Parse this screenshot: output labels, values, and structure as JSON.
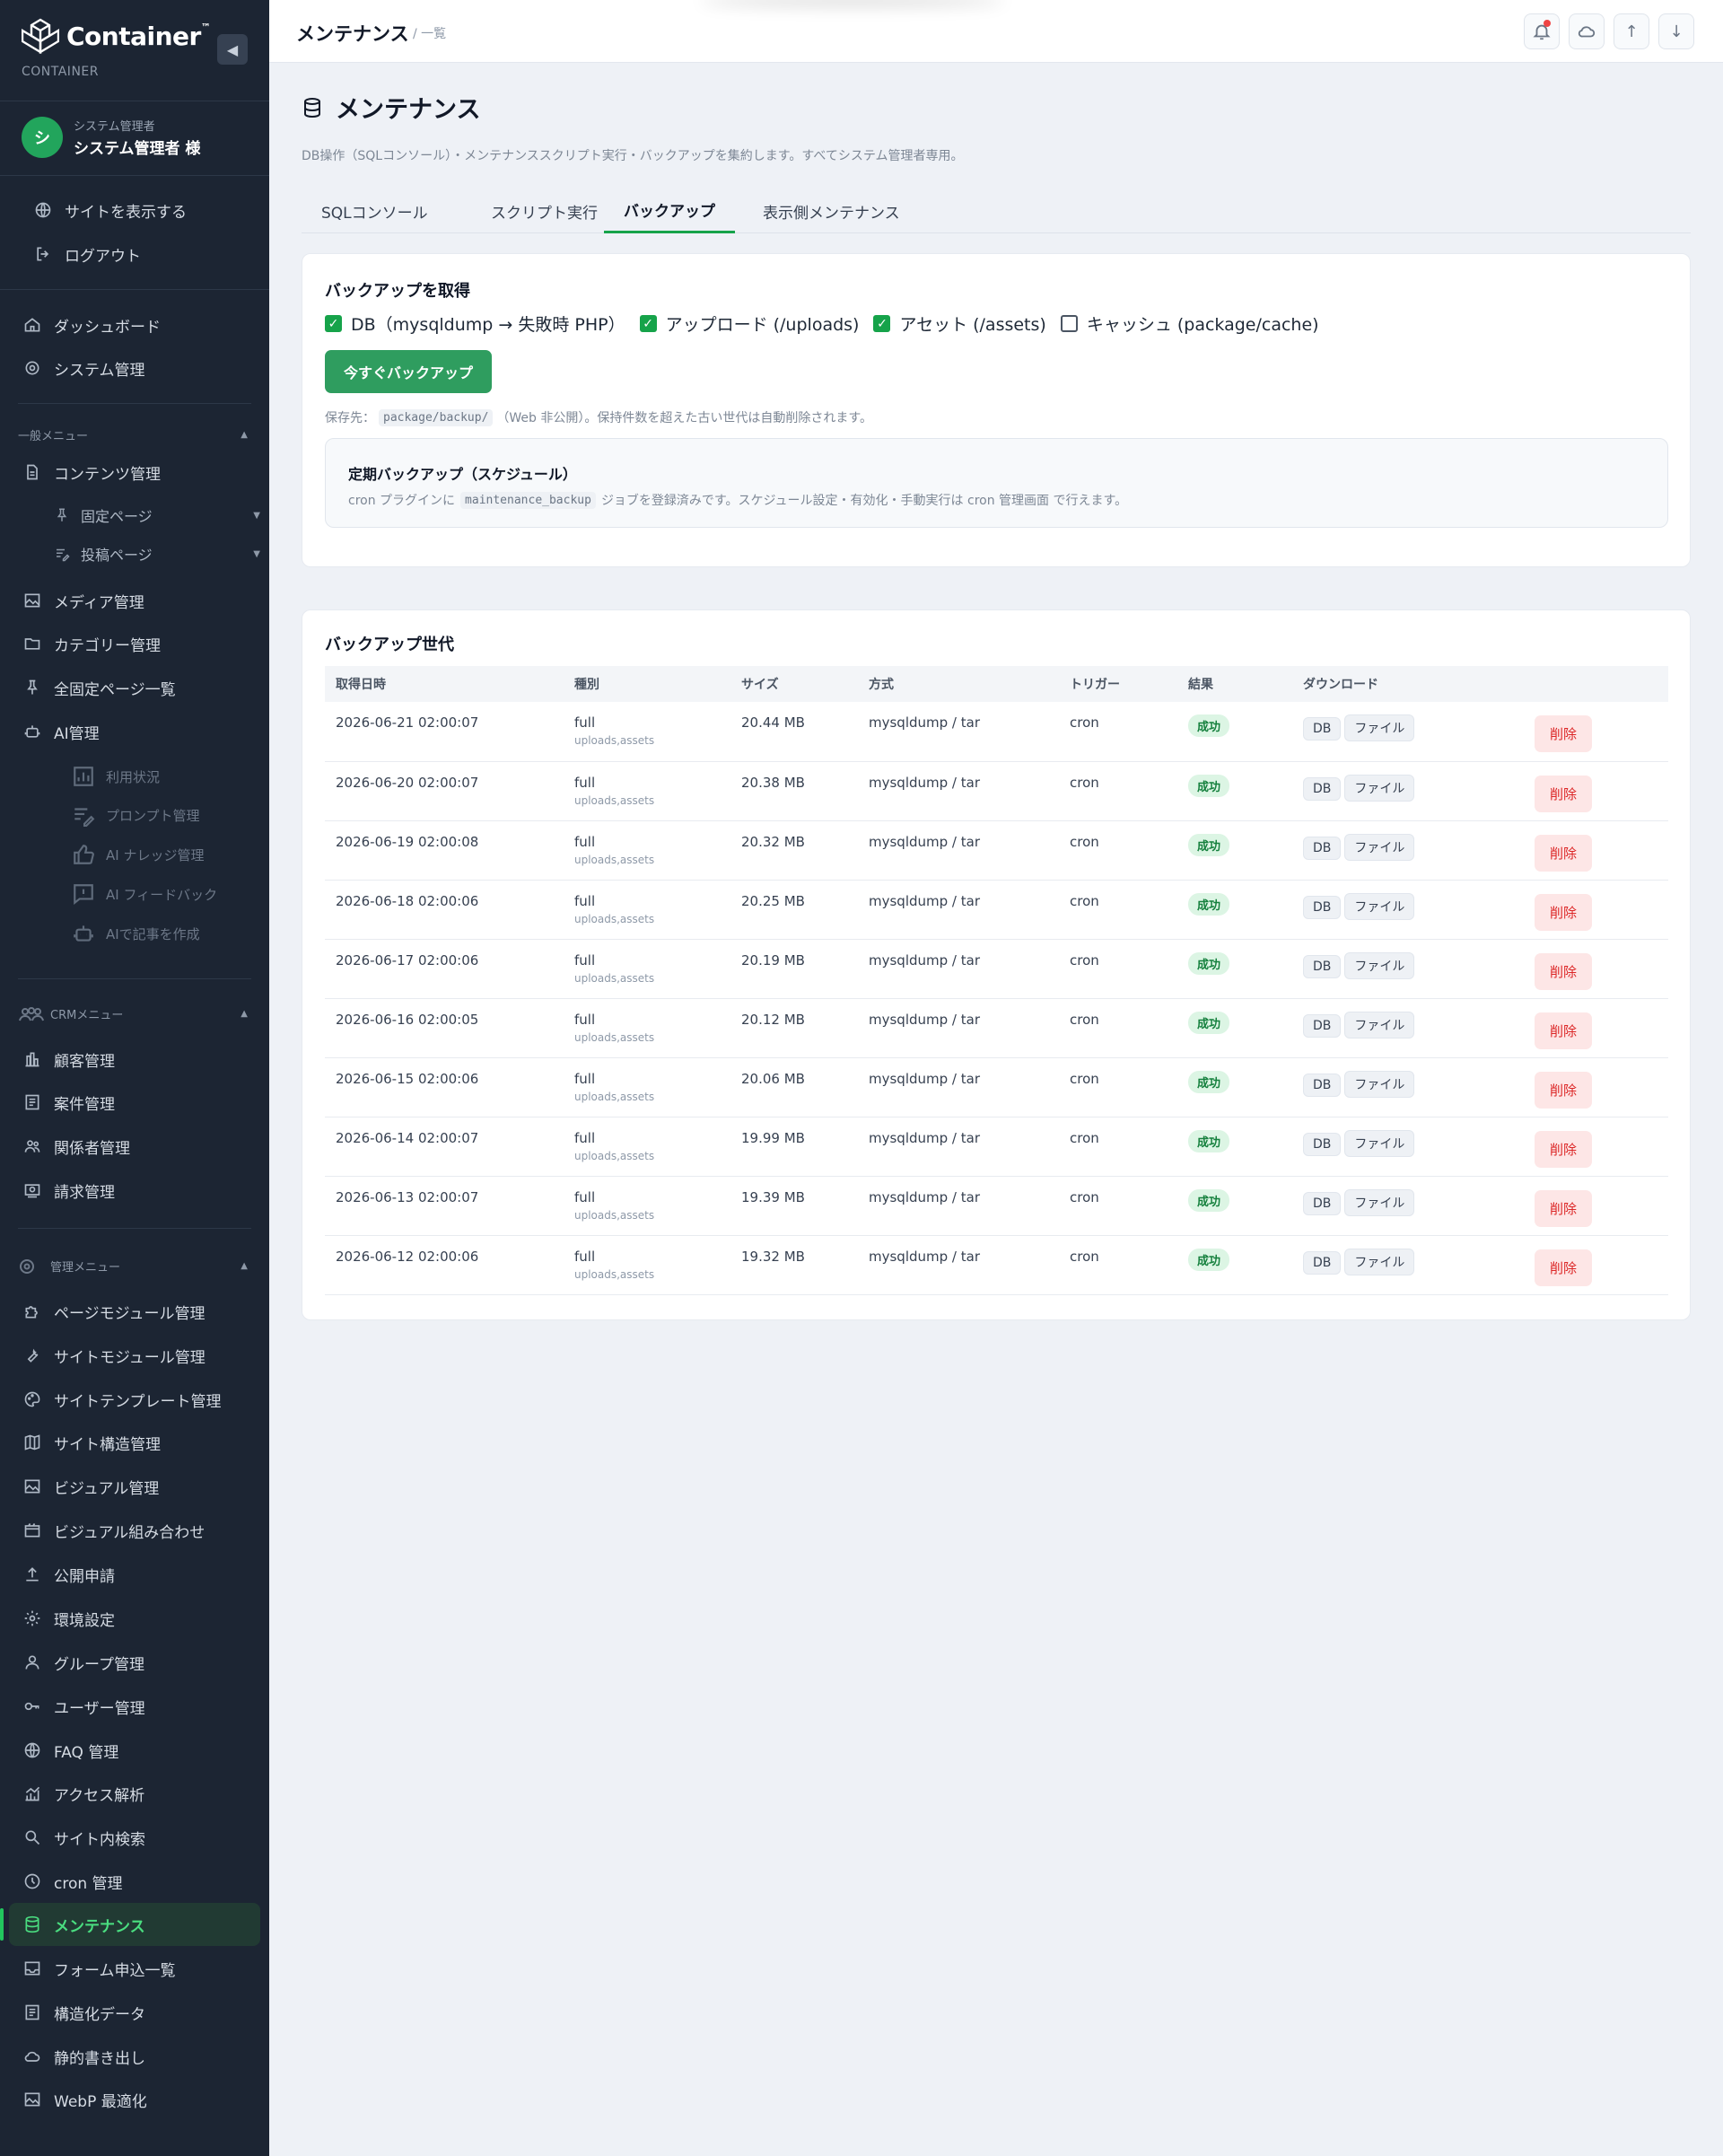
{
  "sidebar": {
    "brand": "Container",
    "brand_tm": "™",
    "brand_sub": "CONTAINER",
    "user_initial": "シ",
    "user_role": "システム管理者",
    "user_name": "システム管理者 様",
    "links": [
      {
        "label": "サイトを表示する",
        "icon": "globe-icon"
      },
      {
        "label": "ログアウト",
        "icon": "logout-icon"
      }
    ],
    "top_items": [
      {
        "label": "ダッシュボード",
        "icon": "home-icon"
      },
      {
        "label": "システム管理",
        "icon": "settings-icon"
      }
    ],
    "general_label": "一般メニュー",
    "general_items": [
      {
        "label": "コンテンツ管理",
        "icon": "document-icon"
      },
      {
        "label": "固定ページ",
        "icon": "pin-icon"
      },
      {
        "label": "投稿ページ",
        "icon": "post-icon"
      },
      {
        "label": "メディア管理",
        "icon": "image-icon"
      },
      {
        "label": "カテゴリー管理",
        "icon": "folder-icon"
      },
      {
        "label": "全固定ページ一覧",
        "icon": "pin-icon"
      },
      {
        "label": "AI管理",
        "icon": "robot-icon"
      }
    ],
    "ai_items": [
      {
        "label": "利用状況",
        "icon": "chart-icon"
      },
      {
        "label": "プロンプト管理",
        "icon": "edit-icon"
      },
      {
        "label": "AI ナレッジ管理",
        "icon": "thumbs-up-icon"
      },
      {
        "label": "AI フィードバック",
        "icon": "feedback-icon"
      },
      {
        "label": "AIで記事を作成",
        "icon": "robot-icon"
      }
    ],
    "crm_label": "CRMメニュー",
    "crm_items": [
      {
        "label": "顧客管理",
        "icon": "building-icon"
      },
      {
        "label": "案件管理",
        "icon": "list-icon"
      },
      {
        "label": "関係者管理",
        "icon": "people-icon"
      },
      {
        "label": "請求管理",
        "icon": "invoice-icon"
      }
    ],
    "admin_label": "管理メニュー",
    "admin_items": [
      {
        "label": "ページモジュール管理",
        "icon": "puzzle-icon"
      },
      {
        "label": "サイトモジュール管理",
        "icon": "wrench-icon"
      },
      {
        "label": "サイトテンプレート管理",
        "icon": "palette-icon"
      },
      {
        "label": "サイト構造管理",
        "icon": "map-icon"
      },
      {
        "label": "ビジュアル管理",
        "icon": "image-icon"
      },
      {
        "label": "ビジュアル組み合わせ",
        "icon": "film-icon"
      },
      {
        "label": "公開申請",
        "icon": "upload-icon"
      },
      {
        "label": "環境設定",
        "icon": "gear-icon"
      },
      {
        "label": "グループ管理",
        "icon": "user-icon"
      },
      {
        "label": "ユーザー管理",
        "icon": "key-icon"
      },
      {
        "label": "FAQ 管理",
        "icon": "globe-icon"
      },
      {
        "label": "アクセス解析",
        "icon": "analytics-icon"
      },
      {
        "label": "サイト内検索",
        "icon": "search-icon"
      },
      {
        "label": "cron 管理",
        "icon": "clock-icon"
      },
      {
        "label": "メンテナンス",
        "icon": "database-icon"
      },
      {
        "label": "フォーム申込一覧",
        "icon": "inbox-icon"
      },
      {
        "label": "構造化データ",
        "icon": "list-icon"
      },
      {
        "label": "静的書き出し",
        "icon": "cloud-icon"
      },
      {
        "label": "WebP 最適化",
        "icon": "image-icon"
      }
    ]
  },
  "header": {
    "title": "メンテナンス",
    "crumb": "/ 一覧",
    "buttons": [
      {
        "icon": "bell-icon"
      },
      {
        "icon": "cloud-icon"
      },
      {
        "icon": "arrow-up-icon",
        "glyph": "↑"
      },
      {
        "icon": "arrow-down-icon",
        "glyph": "↓"
      }
    ]
  },
  "page": {
    "title": "メンテナンス",
    "description": "DB操作（SQLコンソール）・メンテナンススクリプト実行・バックアップを集約します。すべてシステム管理者専用。",
    "tabs": [
      {
        "label": "SQLコンソール",
        "active": false
      },
      {
        "label": "スクリプト実行",
        "active": false
      },
      {
        "label": "バックアップ",
        "active": true
      },
      {
        "label": "表示側メンテナンス",
        "active": false
      }
    ]
  },
  "backup": {
    "title": "バックアップを取得",
    "options": [
      {
        "label": "DB（mysqldump → 失敗時 PHP）",
        "checked": true
      },
      {
        "label": "アップロード (/uploads)",
        "checked": true
      },
      {
        "label": "アセット (/assets)",
        "checked": true
      },
      {
        "label": "キャッシュ (package/cache)",
        "checked": false
      }
    ],
    "button_label": "今すぐバックアップ",
    "save_prefix": "保存先：",
    "save_path": "package/backup/",
    "save_suffix": "（Web 非公開）。保持件数を超えた古い世代は自動削除されます。",
    "schedule_title": "定期バックアップ（スケジュール）",
    "schedule_prefix": "cron プラグインに",
    "schedule_job": "maintenance_backup",
    "schedule_suffix": "ジョブを登録済みです。スケジュール設定・有効化・手動実行は cron 管理画面 で行えます。"
  },
  "generations": {
    "title": "バックアップ世代",
    "columns": [
      "取得日時",
      "種別",
      "サイズ",
      "方式",
      "トリガー",
      "結果",
      "ダウンロード",
      ""
    ],
    "download_db_label": "DB",
    "download_file_label": "ファイル",
    "delete_label": "削除",
    "rows": [
      {
        "datetime": "2026-06-21 02:00:07",
        "type": "full",
        "targets": "uploads,assets",
        "size": "20.44 MB",
        "method": "mysqldump / tar",
        "trigger": "cron",
        "result": "成功"
      },
      {
        "datetime": "2026-06-20 02:00:07",
        "type": "full",
        "targets": "uploads,assets",
        "size": "20.38 MB",
        "method": "mysqldump / tar",
        "trigger": "cron",
        "result": "成功"
      },
      {
        "datetime": "2026-06-19 02:00:08",
        "type": "full",
        "targets": "uploads,assets",
        "size": "20.32 MB",
        "method": "mysqldump / tar",
        "trigger": "cron",
        "result": "成功"
      },
      {
        "datetime": "2026-06-18 02:00:06",
        "type": "full",
        "targets": "uploads,assets",
        "size": "20.25 MB",
        "method": "mysqldump / tar",
        "trigger": "cron",
        "result": "成功"
      },
      {
        "datetime": "2026-06-17 02:00:06",
        "type": "full",
        "targets": "uploads,assets",
        "size": "20.19 MB",
        "method": "mysqldump / tar",
        "trigger": "cron",
        "result": "成功"
      },
      {
        "datetime": "2026-06-16 02:00:05",
        "type": "full",
        "targets": "uploads,assets",
        "size": "20.12 MB",
        "method": "mysqldump / tar",
        "trigger": "cron",
        "result": "成功"
      },
      {
        "datetime": "2026-06-15 02:00:06",
        "type": "full",
        "targets": "uploads,assets",
        "size": "20.06 MB",
        "method": "mysqldump / tar",
        "trigger": "cron",
        "result": "成功"
      },
      {
        "datetime": "2026-06-14 02:00:07",
        "type": "full",
        "targets": "uploads,assets",
        "size": "19.99 MB",
        "method": "mysqldump / tar",
        "trigger": "cron",
        "result": "成功"
      },
      {
        "datetime": "2026-06-13 02:00:07",
        "type": "full",
        "targets": "uploads,assets",
        "size": "19.39 MB",
        "method": "mysqldump / tar",
        "trigger": "cron",
        "result": "成功"
      },
      {
        "datetime": "2026-06-12 02:00:06",
        "type": "full",
        "targets": "uploads,assets",
        "size": "19.32 MB",
        "method": "mysqldump / tar",
        "trigger": "cron",
        "result": "成功"
      }
    ]
  },
  "colors": {
    "sidebar_bg": "#1c2533",
    "accent": "#16a34a",
    "primary_button": "#2f9d5f",
    "danger": "#dc2626",
    "success_badge_bg": "#dcf5e4"
  }
}
